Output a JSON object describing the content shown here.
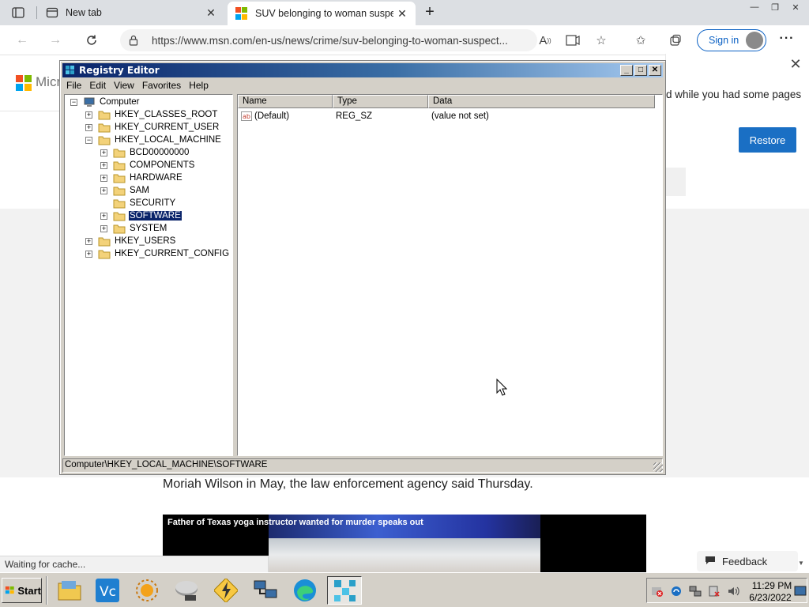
{
  "browser": {
    "tabs": [
      {
        "title": "New tab",
        "active": false
      },
      {
        "title": "SUV belonging to woman suspec",
        "active": true
      }
    ],
    "url": "https://www.msn.com/en-us/news/crime/suv-belonging-to-woman-suspect...",
    "signin_label": "Sign in"
  },
  "page": {
    "logo_text": "Micr",
    "restore_text": "d while you had some pages",
    "restore_button": "Restore",
    "article_line": "Moriah Wilson in May, the law enforcement agency said Thursday.",
    "video_title": "Father of Texas yoga instructor wanted for murder speaks out",
    "status_text": "Waiting for cache...",
    "feedback_label": "Feedback"
  },
  "regedit": {
    "title": "Registry Editor",
    "menu": [
      "File",
      "Edit",
      "View",
      "Favorites",
      "Help"
    ],
    "tree": [
      {
        "label": "Computer",
        "level": 0,
        "expander": "-",
        "kind": "computer"
      },
      {
        "label": "HKEY_CLASSES_ROOT",
        "level": 1,
        "expander": "+"
      },
      {
        "label": "HKEY_CURRENT_USER",
        "level": 1,
        "expander": "+"
      },
      {
        "label": "HKEY_LOCAL_MACHINE",
        "level": 1,
        "expander": "-"
      },
      {
        "label": "BCD00000000",
        "level": 2,
        "expander": "+"
      },
      {
        "label": "COMPONENTS",
        "level": 2,
        "expander": "+"
      },
      {
        "label": "HARDWARE",
        "level": 2,
        "expander": "+"
      },
      {
        "label": "SAM",
        "level": 2,
        "expander": "+"
      },
      {
        "label": "SECURITY",
        "level": 2,
        "expander": ""
      },
      {
        "label": "SOFTWARE",
        "level": 2,
        "expander": "+",
        "selected": true
      },
      {
        "label": "SYSTEM",
        "level": 2,
        "expander": "+"
      },
      {
        "label": "HKEY_USERS",
        "level": 1,
        "expander": "+"
      },
      {
        "label": "HKEY_CURRENT_CONFIG",
        "level": 1,
        "expander": "+"
      }
    ],
    "columns": [
      "Name",
      "Type",
      "Data"
    ],
    "rows": [
      {
        "name": "(Default)",
        "type": "REG_SZ",
        "data": "(value not set)"
      }
    ],
    "status_path": "Computer\\HKEY_LOCAL_MACHINE\\SOFTWARE"
  },
  "taskbar": {
    "start_label": "Start",
    "apps": [
      "file-explorer-icon",
      "vmware-icon",
      "sun-app-icon",
      "disk-app-icon",
      "lightning-app-icon",
      "network-app-icon",
      "edge-icon",
      "regedit-icon"
    ],
    "time": "11:29 PM",
    "date": "6/23/2022"
  },
  "colors": {
    "title_gradient_start": "#0a246a",
    "selection": "#0a246a",
    "restore_button": "#1a6fc4",
    "signin_border": "#0b61c4"
  }
}
